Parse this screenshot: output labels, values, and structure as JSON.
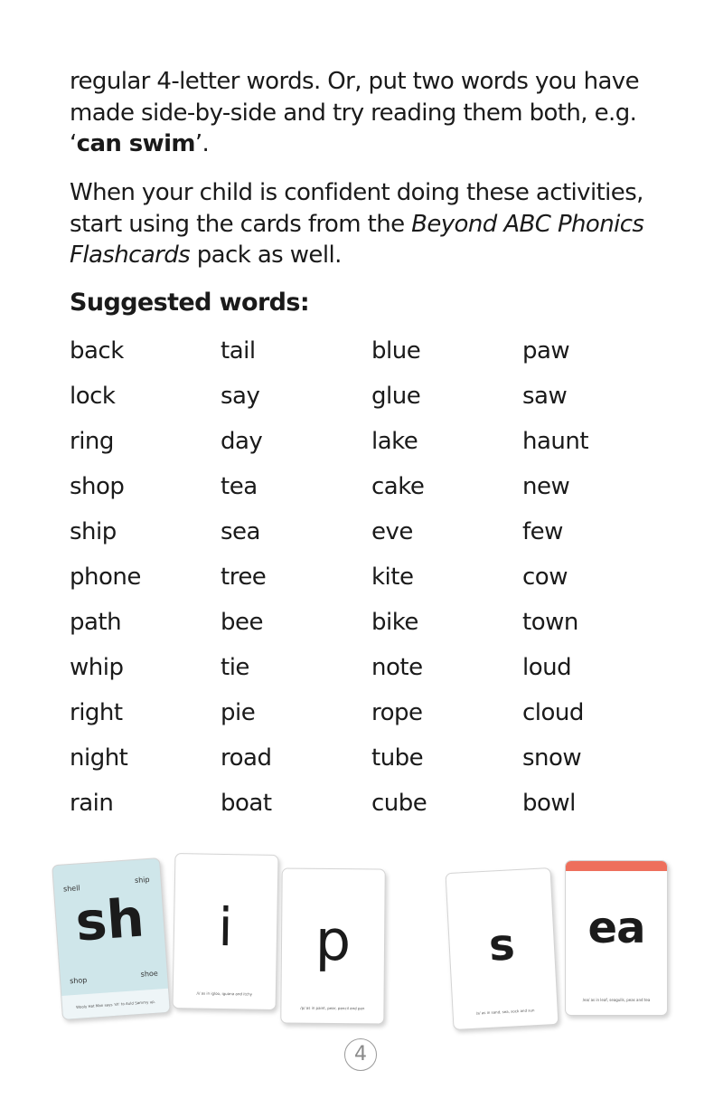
{
  "intro": {
    "p1_text1": "regular 4-letter words. Or, put two words you have made side-by-side and try reading them both, e.g. ‘",
    "p1_bold": "can swim",
    "p1_text2": "’.",
    "p2_text1": "When your child is confident doing these activities, start using the cards from the ",
    "p2_italic": "Beyond ABC Phonics Flashcards",
    "p2_text2": " pack as well."
  },
  "heading": "Suggested words:",
  "words": [
    [
      "back",
      "tail",
      "blue",
      "paw"
    ],
    [
      "lock",
      "say",
      "glue",
      "saw"
    ],
    [
      "ring",
      "day",
      "lake",
      "haunt"
    ],
    [
      "shop",
      "tea",
      "cake",
      "new"
    ],
    [
      "ship",
      "sea",
      "eve",
      "few"
    ],
    [
      "phone",
      "tree",
      "kite",
      "cow"
    ],
    [
      "path",
      "bee",
      "bike",
      "town"
    ],
    [
      "whip",
      "tie",
      "note",
      "loud"
    ],
    [
      "right",
      "pie",
      "rope",
      "cloud"
    ],
    [
      "night",
      "road",
      "tube",
      "snow"
    ],
    [
      "rain",
      "boat",
      "cube",
      "bowl"
    ]
  ],
  "cards": {
    "sh": {
      "glyph": "sh",
      "labels": [
        "shell",
        "ship",
        "shop",
        "shoe"
      ],
      "caption": "Wooly Hat Man says 'sh' to Auld Sammy up.",
      "color": "#cfe6ea"
    },
    "i": {
      "glyph": "i",
      "caption": "/i/ as in igloo, iguana and itchy"
    },
    "p": {
      "glyph": "p",
      "caption": "/p/ as in paint, pear, pencil and pen"
    },
    "s": {
      "glyph": "s",
      "caption": "/s/ as in sand, sea, sock and sun"
    },
    "ea": {
      "glyph": "ea",
      "caption": "/ea/ as in leaf, seagulls, peas and tea",
      "accent": "#ee6f5c"
    }
  },
  "page_number": "4"
}
